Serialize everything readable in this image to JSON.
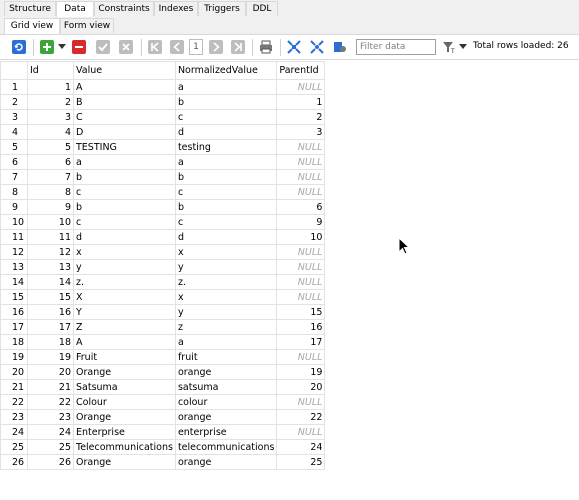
{
  "tabs": [
    "Structure",
    "Data",
    "Constraints",
    "Indexes",
    "Triggers",
    "DDL"
  ],
  "subtabs": [
    "Grid view",
    "Form view"
  ],
  "toolbar": {
    "page_number": "1",
    "filter_placeholder": "Filter data",
    "total_rows": "Total rows loaded: 26"
  },
  "grid": {
    "columns": [
      "Id",
      "Value",
      "NormalizedValue",
      "ParentId"
    ],
    "null_text": "NULL",
    "rows": [
      {
        "n": "1",
        "id": "1",
        "value": "A",
        "norm": "a",
        "parent": "NULL"
      },
      {
        "n": "2",
        "id": "2",
        "value": "B",
        "norm": "b",
        "parent": "1"
      },
      {
        "n": "3",
        "id": "3",
        "value": "C",
        "norm": "c",
        "parent": "2"
      },
      {
        "n": "4",
        "id": "4",
        "value": "D",
        "norm": "d",
        "parent": "3"
      },
      {
        "n": "5",
        "id": "5",
        "value": "TESTING",
        "norm": "testing",
        "parent": "NULL"
      },
      {
        "n": "6",
        "id": "6",
        "value": "a",
        "norm": "a",
        "parent": "NULL"
      },
      {
        "n": "7",
        "id": "7",
        "value": "b",
        "norm": "b",
        "parent": "NULL"
      },
      {
        "n": "8",
        "id": "8",
        "value": "c",
        "norm": "c",
        "parent": "NULL"
      },
      {
        "n": "9",
        "id": "9",
        "value": "b",
        "norm": "b",
        "parent": "6"
      },
      {
        "n": "10",
        "id": "10",
        "value": "c",
        "norm": "c",
        "parent": "9"
      },
      {
        "n": "11",
        "id": "11",
        "value": "d",
        "norm": "d",
        "parent": "10"
      },
      {
        "n": "12",
        "id": "12",
        "value": "x",
        "norm": "x",
        "parent": "NULL"
      },
      {
        "n": "13",
        "id": "13",
        "value": "y",
        "norm": "y",
        "parent": "NULL"
      },
      {
        "n": "14",
        "id": "14",
        "value": "z.",
        "norm": "z.",
        "parent": "NULL"
      },
      {
        "n": "15",
        "id": "15",
        "value": "X",
        "norm": "x",
        "parent": "NULL"
      },
      {
        "n": "16",
        "id": "16",
        "value": "Y",
        "norm": "y",
        "parent": "15"
      },
      {
        "n": "17",
        "id": "17",
        "value": "Z",
        "norm": "z",
        "parent": "16"
      },
      {
        "n": "18",
        "id": "18",
        "value": "A",
        "norm": "a",
        "parent": "17"
      },
      {
        "n": "19",
        "id": "19",
        "value": "Fruit",
        "norm": "fruit",
        "parent": "NULL"
      },
      {
        "n": "20",
        "id": "20",
        "value": "Orange",
        "norm": "orange",
        "parent": "19"
      },
      {
        "n": "21",
        "id": "21",
        "value": "Satsuma",
        "norm": "satsuma",
        "parent": "20"
      },
      {
        "n": "22",
        "id": "22",
        "value": "Colour",
        "norm": "colour",
        "parent": "NULL"
      },
      {
        "n": "23",
        "id": "23",
        "value": "Orange",
        "norm": "orange",
        "parent": "22"
      },
      {
        "n": "24",
        "id": "24",
        "value": "Enterprise",
        "norm": "enterprise",
        "parent": "NULL"
      },
      {
        "n": "25",
        "id": "25",
        "value": "Telecommunications",
        "norm": "telecommunications",
        "parent": "24"
      },
      {
        "n": "26",
        "id": "26",
        "value": "Orange",
        "norm": "orange",
        "parent": "25"
      }
    ]
  },
  "colors": {
    "accent_blue": "#2b6fd6",
    "green": "#3aa635",
    "red": "#d62b2b",
    "null_gray": "#a8a8a8"
  }
}
